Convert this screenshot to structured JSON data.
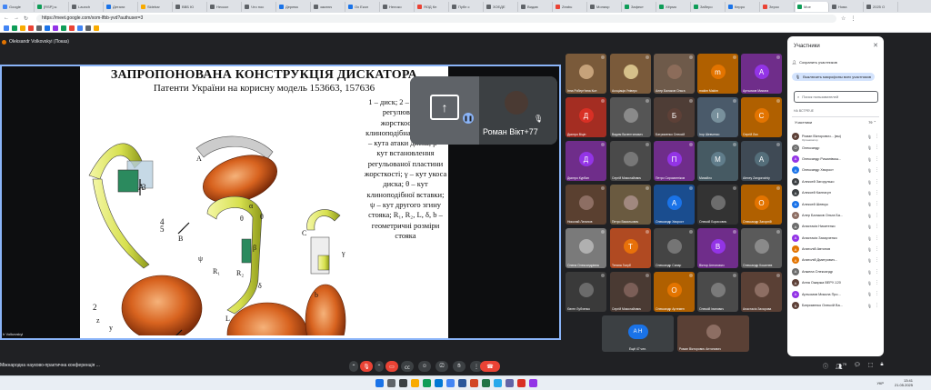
{
  "browser": {
    "tabs": [
      {
        "label": "Google",
        "color": "#4285f4"
      },
      {
        "label": "[RSP] ы",
        "color": "#0f9d58"
      },
      {
        "label": "Launch",
        "color": "#5f6368"
      },
      {
        "label": "Детали",
        "color": "#1a73e8"
      },
      {
        "label": "Sidebar",
        "color": "#f9ab00"
      },
      {
        "label": "ВВБ Ю",
        "color": "#5f6368"
      },
      {
        "label": "Нескол",
        "color": "#5f6368"
      },
      {
        "label": "Что нос",
        "color": "#5f6368"
      },
      {
        "label": "Дерева",
        "color": "#1a73e8"
      },
      {
        "label": "заключ",
        "color": "#5f6368"
      },
      {
        "label": "Ох Екол",
        "color": "#1a73e8"
      },
      {
        "label": "Нелоко",
        "color": "#5f6368"
      },
      {
        "label": "ЯОД Кн",
        "color": "#ea4335"
      },
      {
        "label": "Публ с",
        "color": "#5f6368"
      },
      {
        "label": "ЗОЕДЕ",
        "color": "#5f6368"
      },
      {
        "label": "Видав",
        "color": "#5f6368"
      },
      {
        "label": "Zeabu",
        "color": "#ea4335"
      },
      {
        "label": "Мониор",
        "color": "#5f6368"
      },
      {
        "label": "Зафект",
        "color": "#0f9d58"
      },
      {
        "label": "Хёрмо",
        "color": "#0f9d58"
      },
      {
        "label": "Заберо",
        "color": "#0f9d58"
      },
      {
        "label": "Керро",
        "color": "#1a73e8"
      },
      {
        "label": "Зерос",
        "color": "#ea4335"
      },
      {
        "label": "Мое",
        "color": "#0f9d58"
      },
      {
        "label": "Нова",
        "color": "#5f6368"
      },
      {
        "label": "2025 О",
        "color": "#5f6368"
      }
    ],
    "url": "https://meet.google.com/xom-lfbb-yvd?authuser=3"
  },
  "meet": {
    "presenter_label": "Oleksandr Volkovskyi (Показ)",
    "presenter_short": "Ir Volkovskyi",
    "slide": {
      "title": "ЗАПРОПОНОВАНА КОНСТРУКЦІЯ ДИСКАТОРА",
      "subtitle": "Патенти України на корисну модель 153663, 157636",
      "description": "1 – диск; 2 – стояк; 3 – регулювальна жорсткості; 4 – клиноподібна вставка; α – кута атаки диска; β – кут встановлення регульованої пластини жорсткості; γ – кут укоса диска; θ – кут клиноподібної вставки; ψ – кут другого згину стояка; R₁, R₂, L, δ, b – геометричні розміри стояка"
    },
    "pill": {
      "name": "Роман Вікт",
      "count": "+77"
    },
    "tiles": [
      {
        "name": "Інна Роберт'івна Кол",
        "bg": "#7a5a3a",
        "avatar": "",
        "avbg": "#c6a27a"
      },
      {
        "name": "Асоціація Універс",
        "bg": "#7a5a3a",
        "avatar": "",
        "avbg": "#d6c08a"
      },
      {
        "name": "Алер Балаков Ольга",
        "bg": "#6e5a4a",
        "avatar": "",
        "avbg": "#8c6c5a"
      },
      {
        "name": "makim Makim",
        "bg": "#b06000",
        "avatar": "m",
        "avbg": "#e37400"
      },
      {
        "name": "Артьомов Микола",
        "bg": "#6f2d8a",
        "avatar": "А",
        "avbg": "#9334e6"
      },
      {
        "name": "Дмитро Віцін",
        "bg": "#a42d22",
        "avatar": "Д",
        "avbg": "#d93025"
      },
      {
        "name": "Вадим Валентинович",
        "bg": "#555",
        "avatar": "",
        "avbg": "#8a8a8a"
      },
      {
        "name": "Батрименко Олексій",
        "bg": "#4e3d36",
        "avatar": "Б",
        "avbg": "#5d4037"
      },
      {
        "name": "Ігор Шевченко",
        "bg": "#4a5a6a",
        "avatar": "І",
        "avbg": "#78909c"
      },
      {
        "name": "Сергій Лях",
        "bg": "#b06000",
        "avatar": "С",
        "avbg": "#e37400"
      },
      {
        "name": "Дмитро Курбан",
        "bg": "#6f2d8a",
        "avatar": "Д",
        "avbg": "#9334e6"
      },
      {
        "name": "Сергій Миколайович",
        "bg": "#4a4a4a",
        "avatar": "",
        "avbg": "#777"
      },
      {
        "name": "Петро Сиромятніков",
        "bg": "#6f2d8a",
        "avatar": "П",
        "avbg": "#9334e6"
      },
      {
        "name": "Михайло",
        "bg": "#465a63",
        "avatar": "М",
        "avbg": "#607d8b"
      },
      {
        "name": "Alexey Zavgorodniy",
        "bg": "#3f4a55",
        "avatar": "А",
        "avbg": "#546e7a"
      },
      {
        "name": "Николай Латанов",
        "bg": "#5a4030",
        "avatar": "",
        "avbg": "#8d6e63"
      },
      {
        "name": "Петро Васильович",
        "bg": "#6a5a40",
        "avatar": "",
        "avbg": "#a1887f"
      },
      {
        "name": "Олександр Хворост",
        "bg": "#1a4d8f",
        "avatar": "А",
        "avbg": "#1a73e8"
      },
      {
        "name": "Олексій Борисович",
        "bg": "#333",
        "avatar": "",
        "avbg": "#6d6d6d"
      },
      {
        "name": "Олександр Загорній",
        "bg": "#b06000",
        "avatar": "О",
        "avbg": "#e37400"
      },
      {
        "name": "Олена Олександрівна",
        "bg": "#7a7a7a",
        "avatar": "",
        "avbg": "#b0b0b0"
      },
      {
        "name": "Тетяна Голуб",
        "bg": "#b04a22",
        "avatar": "Т",
        "avbg": "#e8710a"
      },
      {
        "name": "Олександр Сапар",
        "bg": "#444",
        "avatar": "",
        "avbg": "#757575"
      },
      {
        "name": "Віктор Антонович",
        "bg": "#6f2d8a",
        "avatar": "В",
        "avbg": "#9334e6"
      },
      {
        "name": "Олександр Кошелев",
        "bg": "#5a5a5a",
        "avatar": "",
        "avbg": "#8a8a8a"
      },
      {
        "name": "Євген Лубченко",
        "bg": "#3a3a3a",
        "avatar": "",
        "avbg": "#6b6b6b"
      },
      {
        "name": "Сергій Миколайович",
        "bg": "#4a3a33",
        "avatar": "",
        "avbg": "#7b5e57"
      },
      {
        "name": "Олександр Артемен",
        "bg": "#b06000",
        "avatar": "О",
        "avbg": "#e37400"
      },
      {
        "name": "Олексій Іванович",
        "bg": "#4a4a4a",
        "avatar": "",
        "avbg": "#7a7a7a"
      },
      {
        "name": "Анастасія Захарова",
        "bg": "#5a4035",
        "avatar": "",
        "avbg": "#8d6e63"
      }
    ],
    "others_label": "Ещё 47 чел.",
    "bottom_tile_name": "Роман Вікторович Антонович",
    "panel": {
      "title": "Участники",
      "add_label": "Сохранить участников",
      "mute_all_label": "Выключить микрофоны всех участников",
      "search_placeholder": "Поиск пользователей",
      "section_label": "НА ВСТРЕЧЕ",
      "group_label": "Участники",
      "group_count": "79",
      "people": [
        {
          "name": "Роман Вікторович... (вы)",
          "sub": "Организатор",
          "color": "#5d4037",
          "initial": "Р"
        },
        {
          "name": "Олександр",
          "color": "#6d6d6d",
          "initial": "О"
        },
        {
          "name": "Олександр Рижанівськ...",
          "color": "#9334e6",
          "initial": "А"
        },
        {
          "name": "Олександр Хворост",
          "color": "#1a73e8",
          "initial": "А"
        },
        {
          "name": "Алексей Загорулько",
          "color": "#3c4043",
          "initial": "А"
        },
        {
          "name": "Алексей Калнагул",
          "color": "#3c4043",
          "initial": "А"
        },
        {
          "name": "Алексей Шевчук",
          "color": "#1a73e8",
          "initial": "А"
        },
        {
          "name": "Алер Балаков Ольга Ба...",
          "color": "#8d6e63",
          "initial": "А"
        },
        {
          "name": "Анастасія Никитенко",
          "color": "#6d6d6d",
          "initial": "А"
        },
        {
          "name": "Анастасія Захарченко",
          "color": "#9334e6",
          "initial": "А"
        },
        {
          "name": "Анатолій Автонов",
          "color": "#e37400",
          "initial": "А"
        },
        {
          "name": "Анатолій Дмитрович...",
          "color": "#e37400",
          "initial": "А"
        },
        {
          "name": "Анжела Олександр",
          "color": "#6d6d6d",
          "initial": "А"
        },
        {
          "name": "Анна Ожаржа ВЕРУ-120",
          "color": "#5d4037",
          "initial": "А"
        },
        {
          "name": "Артьомов Микола Про...",
          "color": "#9334e6",
          "initial": "А"
        },
        {
          "name": "Батрименко Олексій Ва...",
          "color": "#5d4037",
          "initial": "Б"
        }
      ]
    },
    "meeting_title": "Міжнародна науково-практична конференція ...",
    "participants_badge": "79"
  },
  "taskbar": {
    "time": "13:41",
    "date": "21.05.2025",
    "lang": "УКР"
  }
}
